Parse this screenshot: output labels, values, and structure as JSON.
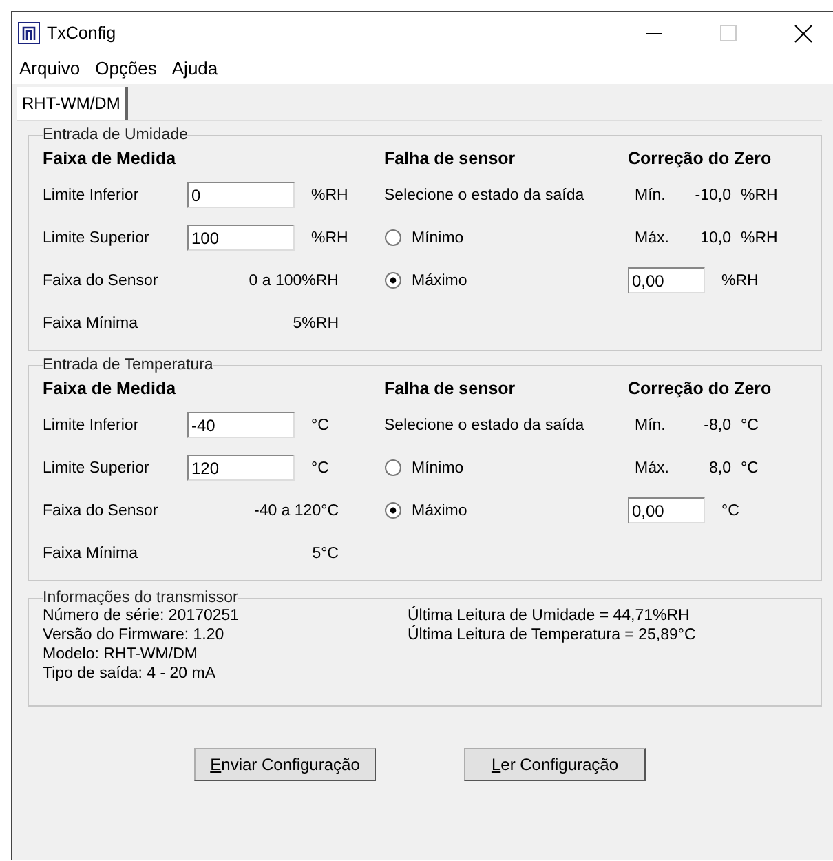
{
  "window": {
    "title": "TxConfig"
  },
  "menu": [
    "Arquivo",
    "Opções",
    "Ajuda"
  ],
  "tabs": [
    {
      "label": "RHT-WM/DM",
      "selected": true
    }
  ],
  "groups": [
    {
      "title": "Entrada de Umidade",
      "range": {
        "heading": "Faixa de Medida",
        "lower": {
          "label": "Limite Inferior",
          "value": "0",
          "unit": "%RH"
        },
        "upper": {
          "label": "Limite Superior",
          "value": "100",
          "unit": "%RH"
        },
        "sensor_range": {
          "label": "Faixa do Sensor",
          "value": "0 a 100%RH"
        },
        "min_range": {
          "label": "Faixa Mínima",
          "value": "5%RH"
        }
      },
      "failure": {
        "heading": "Falha de sensor",
        "prompt": "Selecione o estado da saída",
        "options": [
          {
            "label": "Mínimo",
            "selected": false
          },
          {
            "label": "Máximo",
            "selected": true
          }
        ]
      },
      "zero": {
        "heading": "Correção do Zero",
        "min": {
          "label": "Mín.",
          "value": "-10,0",
          "unit": "%RH"
        },
        "max": {
          "label": "Máx.",
          "value": "10,0",
          "unit": "%RH"
        },
        "offset": {
          "value": "0,00",
          "unit": "%RH"
        }
      }
    },
    {
      "title": "Entrada de Temperatura",
      "range": {
        "heading": "Faixa de Medida",
        "lower": {
          "label": "Limite Inferior",
          "value": "-40",
          "unit": "°C"
        },
        "upper": {
          "label": "Limite Superior",
          "value": "120",
          "unit": "°C"
        },
        "sensor_range": {
          "label": "Faixa do Sensor",
          "value": "-40 a 120°C"
        },
        "min_range": {
          "label": "Faixa Mínima",
          "value": "5°C"
        }
      },
      "failure": {
        "heading": "Falha de sensor",
        "prompt": "Selecione o estado da saída",
        "options": [
          {
            "label": "Mínimo",
            "selected": false
          },
          {
            "label": "Máximo",
            "selected": true
          }
        ]
      },
      "zero": {
        "heading": "Correção do Zero",
        "min": {
          "label": "Mín.",
          "value": "-8,0",
          "unit": "°C"
        },
        "max": {
          "label": "Máx.",
          "value": "8,0",
          "unit": "°C"
        },
        "offset": {
          "value": "0,00",
          "unit": "°C"
        }
      }
    }
  ],
  "info": {
    "title": "Informações do transmissor",
    "left": [
      "Número de série: 20170251",
      "Versão do Firmware: 1.20",
      "Modelo: RHT-WM/DM",
      "Tipo de saída: 4 - 20 mA"
    ],
    "right": [
      "Última Leitura de Umidade = 44,71%RH",
      "Última Leitura de Temperatura = 25,89°C"
    ]
  },
  "buttons": [
    {
      "label": "Enviar Configuração",
      "mnemonic": true
    },
    {
      "label": "Ler Configuração",
      "mnemonic": true
    }
  ]
}
